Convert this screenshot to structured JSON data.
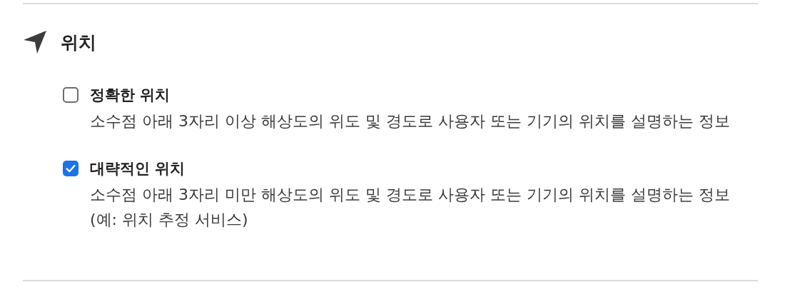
{
  "section": {
    "title": "위치"
  },
  "options": [
    {
      "label": "정확한 위치",
      "description": "소수점 아래 3자리 이상 해상도의 위도 및 경도로 사용자 또는 기기의 위치를 설명하는 정보",
      "checked": false
    },
    {
      "label": "대략적인 위치",
      "description": "소수점 아래 3자리 미만 해상도의 위도 및 경도로 사용자 또는 기기의 위치를 설명하는 정보 (예: 위치 추정 서비스)",
      "checked": true
    }
  ]
}
